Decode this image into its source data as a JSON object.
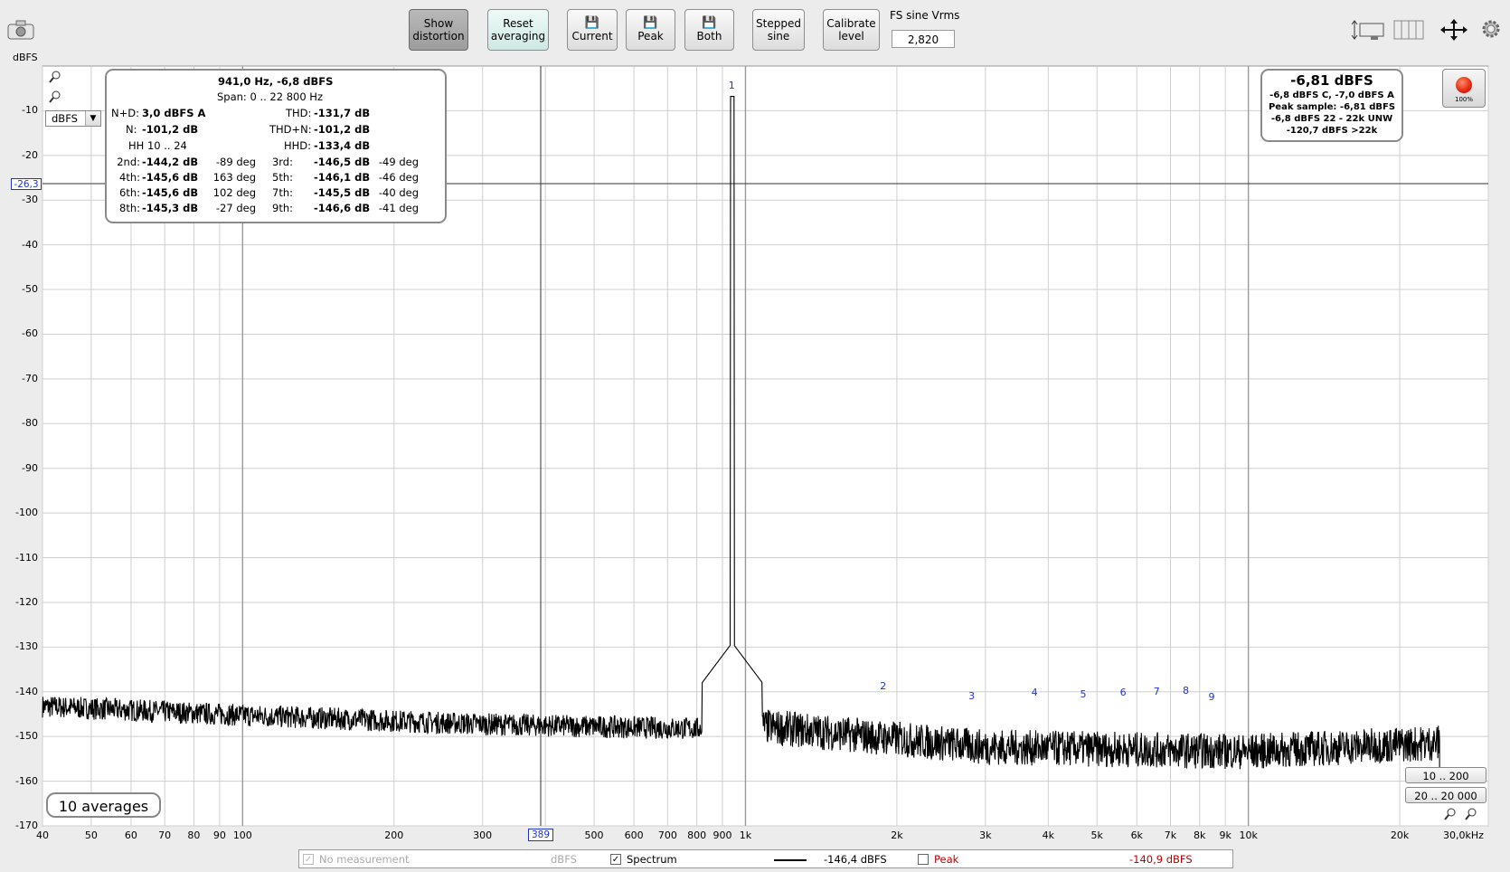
{
  "toolbar": {
    "show_distortion": [
      "Show",
      "distortion"
    ],
    "reset_averaging": [
      "Reset",
      "averaging"
    ],
    "current_label": "Current",
    "peak_label": "Peak",
    "both_label": "Both",
    "stepped_sine": [
      "Stepped",
      "sine"
    ],
    "calibrate_level": [
      "Calibrate",
      "level"
    ],
    "fs_sine_label": "FS sine Vrms",
    "fs_sine_value": "2,820"
  },
  "axis": {
    "y_unit": "dBFS",
    "y_ticks": [
      "-10",
      "-20",
      "-30",
      "-40",
      "-50",
      "-60",
      "-70",
      "-80",
      "-90",
      "-100",
      "-110",
      "-120",
      "-130",
      "-140",
      "-150",
      "-160",
      "-170"
    ],
    "x_ticks": [
      "40",
      "50",
      "60",
      "70",
      "80",
      "90",
      "100",
      "200",
      "300",
      "400",
      "500",
      "600",
      "700",
      "800",
      "900",
      "1k",
      "2k",
      "3k",
      "4k",
      "5k",
      "6k",
      "7k",
      "8k",
      "9k",
      "10k",
      "20k",
      "30,0kHz"
    ],
    "y_cursor_label": "-26,3",
    "x_cursor_label": "389"
  },
  "unit_select": "dBFS",
  "distortion": {
    "header": "941,0 Hz, -6,8 dBFS",
    "span": "Span: 0 .. 22 800 Hz",
    "nd_label": "N+D:",
    "nd_value": "3,0 dBFS A",
    "n_label": "N:",
    "n_value": "-101,2 dB",
    "hh_label": "HH 10 .. 24",
    "thd_label": "THD:",
    "thd_value": "-131,7 dB",
    "thdn_label": "THD+N:",
    "thdn_value": "-101,2 dB",
    "hhd_label": "HHD:",
    "hhd_value": "-133,4 dB",
    "harmonics": [
      {
        "l1": "2nd:",
        "v1": "-144,2 dB",
        "p1": "-89 deg",
        "l2": "3rd:",
        "v2": "-146,5 dB",
        "p2": "-49 deg"
      },
      {
        "l1": "4th:",
        "v1": "-145,6 dB",
        "p1": "163 deg",
        "l2": "5th:",
        "v2": "-146,1 dB",
        "p2": "-46 deg"
      },
      {
        "l1": "6th:",
        "v1": "-145,6 dB",
        "p1": "102 deg",
        "l2": "7th:",
        "v2": "-145,5 dB",
        "p2": "-40 deg"
      },
      {
        "l1": "8th:",
        "v1": "-145,3 dB",
        "p1": "-27 deg",
        "l2": "9th:",
        "v2": "-146,6 dB",
        "p2": "-41 deg"
      }
    ]
  },
  "level": {
    "main": "-6,81 dBFS",
    "line1": "-6,8 dBFS C, -7,0 dBFS A",
    "line2": "Peak sample: -6,81 dBFS",
    "line3": "-6,8 dBFS 22 - 22k UNW",
    "line4": "-120,7 dBFS >22k"
  },
  "record_percent": "100%",
  "averages": "10 averages",
  "range_buttons": [
    "10 .. 200",
    "20 .. 20 000"
  ],
  "harmonic_markers": [
    "1",
    "2",
    "3",
    "4",
    "5",
    "6",
    "7",
    "8",
    "9"
  ],
  "legend": {
    "no_measurement": "No measurement",
    "no_measurement_unit": "dBFS",
    "spectrum": "Spectrum",
    "spectrum_value": "-146,4 dBFS",
    "peak": "Peak",
    "peak_value": "-140,9 dBFS"
  },
  "colors": {
    "trace": "#000000",
    "marker": "#2233cc",
    "peak_legend": "#c00000",
    "grid": "#cfcfcf"
  },
  "chart_data": {
    "type": "line",
    "x_scale": "log",
    "xlim": [
      40,
      30000
    ],
    "ylim": [
      -170,
      0
    ],
    "fundamental": {
      "freq_hz": 941,
      "level_dbfs": -6.8
    },
    "noise_floor_dbfs": [
      [
        40,
        -143
      ],
      [
        100,
        -145
      ],
      [
        300,
        -147
      ],
      [
        800,
        -148
      ],
      [
        1000,
        -147
      ],
      [
        3000,
        -152
      ],
      [
        10000,
        -153
      ],
      [
        24000,
        -151
      ]
    ],
    "harmonics_dbfs": [
      [
        1882,
        -144.2
      ],
      [
        2823,
        -146.5
      ],
      [
        3764,
        -145.6
      ],
      [
        4705,
        -146.1
      ],
      [
        5646,
        -145.6
      ],
      [
        6587,
        -145.5
      ],
      [
        7528,
        -145.3
      ],
      [
        8469,
        -146.6
      ]
    ],
    "series": [
      {
        "name": "Spectrum"
      }
    ],
    "cursor": {
      "x": 389,
      "y": -26.3
    }
  }
}
